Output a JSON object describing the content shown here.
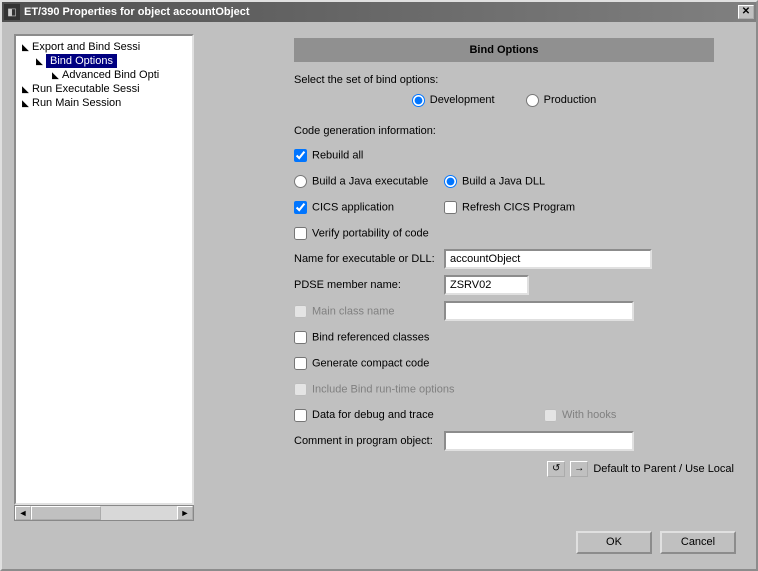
{
  "title": "ET/390 Properties for object accountObject",
  "tree": {
    "items": [
      {
        "label": "Export and Bind Sessi",
        "level": 0
      },
      {
        "label": "Bind Options",
        "level": 1,
        "selected": true
      },
      {
        "label": "Advanced Bind Opti",
        "level": 2
      },
      {
        "label": "Run Executable Sessi",
        "level": 0
      },
      {
        "label": "Run Main Session",
        "level": 0
      }
    ]
  },
  "panel": {
    "header": "Bind Options",
    "select_prompt": "Select the set of bind options:",
    "radio_dev": "Development",
    "radio_prod": "Production",
    "codegen_label": "Code generation information:",
    "rebuild_all": "Rebuild all",
    "build_java_exec": "Build a Java executable",
    "build_java_dll": "Build a Java DLL",
    "cics_app": "CICS application",
    "refresh_cics": "Refresh CICS Program",
    "verify_port": "Verify portability of code",
    "name_exec_label": "Name for executable or DLL:",
    "name_exec_value": "accountObject",
    "pdse_label": "PDSE member name:",
    "pdse_value": "ZSRV02",
    "main_class": "Main class name",
    "bind_ref": "Bind referenced classes",
    "gen_compact": "Generate compact code",
    "include_bind_rt": "Include Bind run-time options",
    "data_debug": "Data for debug and trace",
    "with_hooks": "With hooks",
    "comment_label": "Comment in program object:",
    "default_label": "Default to Parent / Use Local"
  },
  "buttons": {
    "ok": "OK",
    "cancel": "Cancel"
  }
}
